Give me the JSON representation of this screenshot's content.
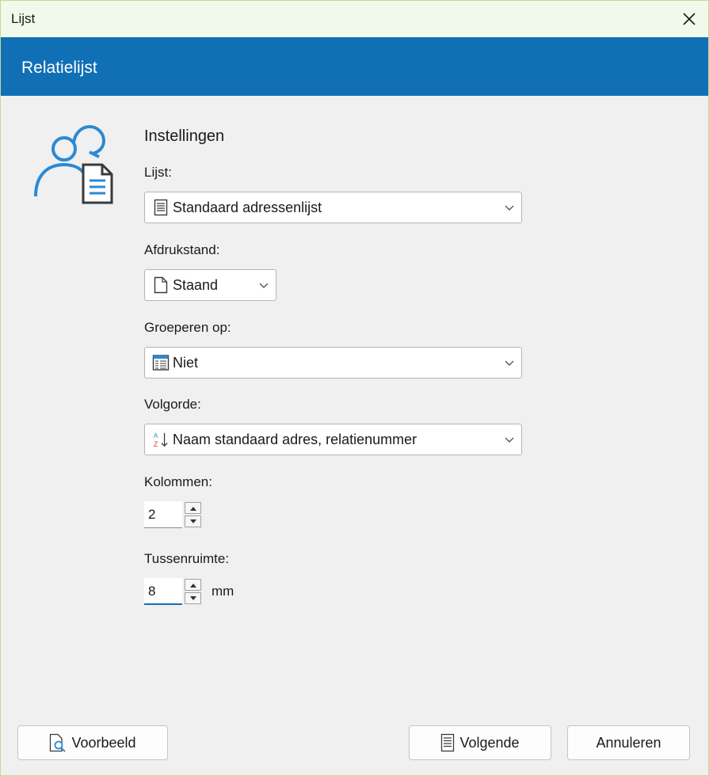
{
  "window": {
    "title": "Lijst"
  },
  "banner": {
    "title": "Relatielijst"
  },
  "section": {
    "title": "Instellingen"
  },
  "fields": {
    "lijst": {
      "label": "Lijst:",
      "value": "Standaard adressenlijst"
    },
    "afdrukstand": {
      "label": "Afdrukstand:",
      "value": "Staand"
    },
    "groeperen": {
      "label": "Groeperen op:",
      "value": "Niet"
    },
    "volgorde": {
      "label": "Volgorde:",
      "value": "Naam standaard adres, relatienummer"
    },
    "kolommen": {
      "label": "Kolommen:",
      "value": "2"
    },
    "tussenruimte": {
      "label": "Tussenruimte:",
      "value": "8",
      "unit": "mm"
    }
  },
  "buttons": {
    "preview": "Voorbeeld",
    "next": "Volgende",
    "cancel": "Annuleren"
  },
  "colors": {
    "accent": "#116fb6",
    "titlebar": "#f0f9ec",
    "background": "#f0f0f0"
  }
}
